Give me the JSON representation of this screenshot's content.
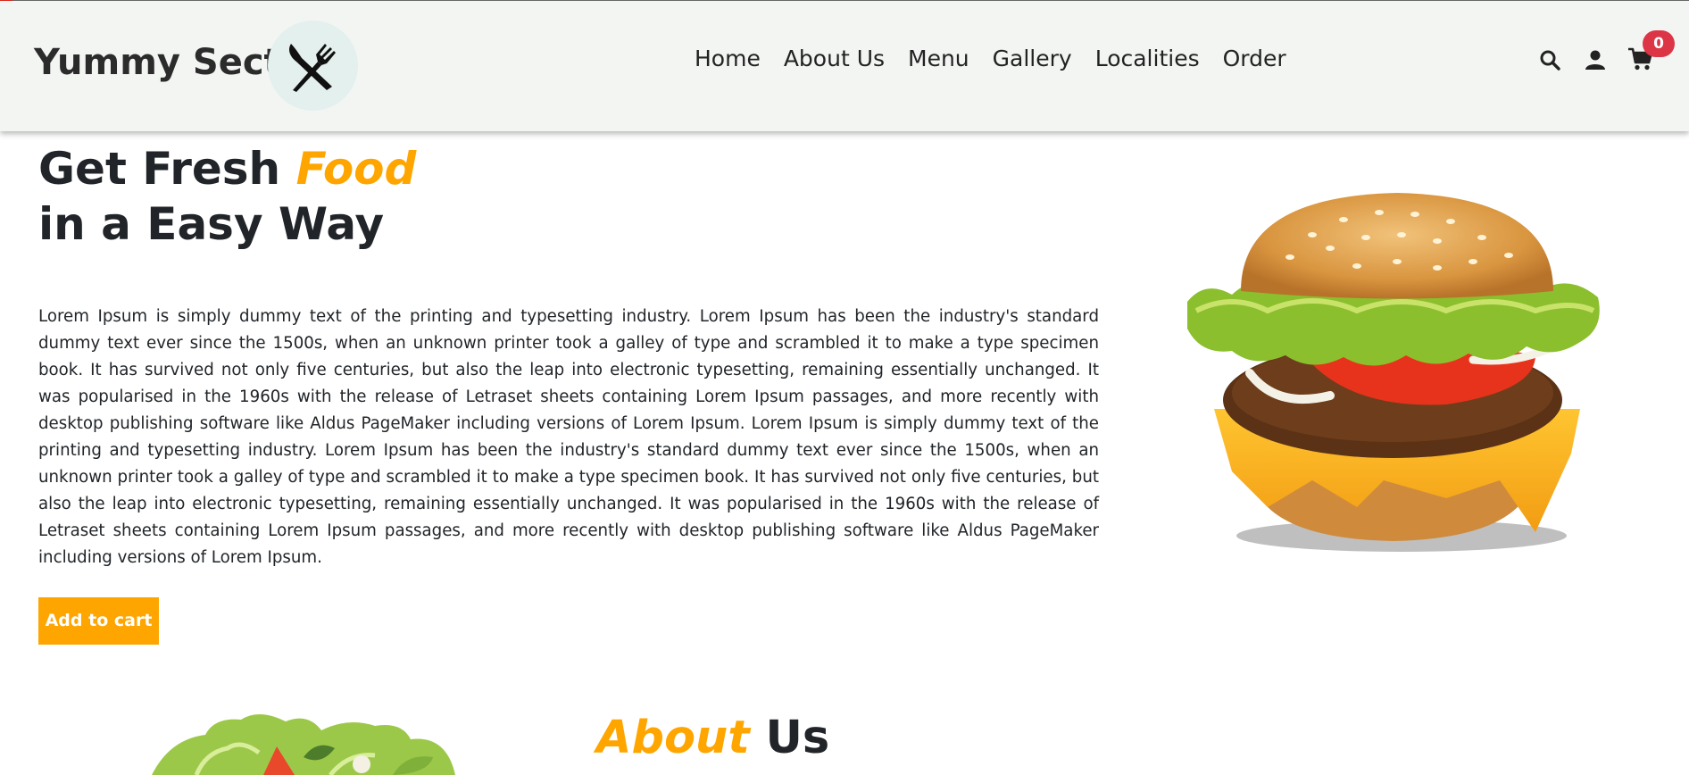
{
  "header": {
    "brand": "Yummy Section",
    "logo_icon": "fork-knife-icon",
    "nav": [
      "Home",
      "About Us",
      "Menu",
      "Gallery",
      "Localities",
      "Order"
    ],
    "icons": [
      "search-icon",
      "user-icon",
      "cart-icon"
    ],
    "cart_count": "0"
  },
  "hero": {
    "title_line1_prefix": "Get Fresh ",
    "title_line1_accent": "Food",
    "title_line2": "in a Easy Way",
    "paragraph": "Lorem Ipsum is simply dummy text of the printing and typesetting industry. Lorem Ipsum has been the industry's standard dummy text ever since the 1500s, when an unknown printer took a galley of type and scrambled it to make a type specimen book. It has survived not only five centuries, but also the leap into electronic typesetting, remaining essentially unchanged. It was popularised in the 1960s with the release of Letraset sheets containing Lorem Ipsum passages, and more recently with desktop publishing software like Aldus PageMaker including versions of Lorem Ipsum. Lorem Ipsum is simply dummy text of the printing and typesetting industry. Lorem Ipsum has been the industry's standard dummy text ever since the 1500s, when an unknown printer took a galley of type and scrambled it to make a type specimen book. It has survived not only five centuries, but also the leap into electronic typesetting, remaining essentially unchanged. It was popularised in the 1960s with the release of Letraset sheets containing Lorem Ipsum passages, and more recently with desktop publishing software like Aldus PageMaker including versions of Lorem Ipsum.",
    "button_label": "Add to cart",
    "image": "burger-image"
  },
  "about": {
    "title_accent": "About",
    "title_rest": " Us",
    "image": "salad-image"
  },
  "colors": {
    "accent": "#ffa500",
    "badge": "#dc3545",
    "header_bg": "#f3f5f3"
  }
}
